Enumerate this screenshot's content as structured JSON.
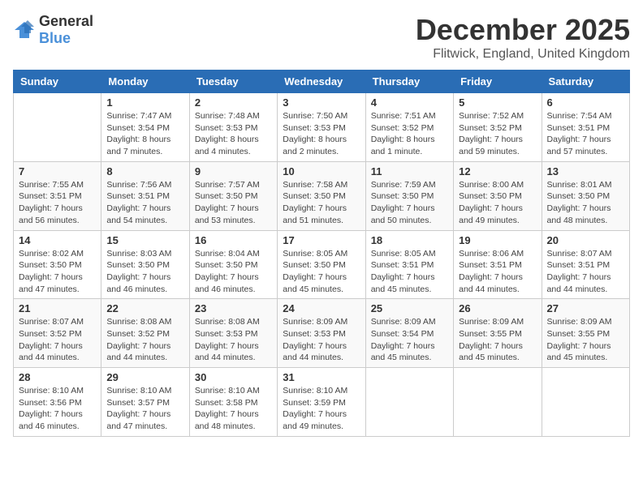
{
  "logo": {
    "general": "General",
    "blue": "Blue"
  },
  "header": {
    "month": "December 2025",
    "location": "Flitwick, England, United Kingdom"
  },
  "weekdays": [
    "Sunday",
    "Monday",
    "Tuesday",
    "Wednesday",
    "Thursday",
    "Friday",
    "Saturday"
  ],
  "weeks": [
    [
      {
        "day": "",
        "info": ""
      },
      {
        "day": "1",
        "info": "Sunrise: 7:47 AM\nSunset: 3:54 PM\nDaylight: 8 hours\nand 7 minutes."
      },
      {
        "day": "2",
        "info": "Sunrise: 7:48 AM\nSunset: 3:53 PM\nDaylight: 8 hours\nand 4 minutes."
      },
      {
        "day": "3",
        "info": "Sunrise: 7:50 AM\nSunset: 3:53 PM\nDaylight: 8 hours\nand 2 minutes."
      },
      {
        "day": "4",
        "info": "Sunrise: 7:51 AM\nSunset: 3:52 PM\nDaylight: 8 hours\nand 1 minute."
      },
      {
        "day": "5",
        "info": "Sunrise: 7:52 AM\nSunset: 3:52 PM\nDaylight: 7 hours\nand 59 minutes."
      },
      {
        "day": "6",
        "info": "Sunrise: 7:54 AM\nSunset: 3:51 PM\nDaylight: 7 hours\nand 57 minutes."
      }
    ],
    [
      {
        "day": "7",
        "info": "Sunrise: 7:55 AM\nSunset: 3:51 PM\nDaylight: 7 hours\nand 56 minutes."
      },
      {
        "day": "8",
        "info": "Sunrise: 7:56 AM\nSunset: 3:51 PM\nDaylight: 7 hours\nand 54 minutes."
      },
      {
        "day": "9",
        "info": "Sunrise: 7:57 AM\nSunset: 3:50 PM\nDaylight: 7 hours\nand 53 minutes."
      },
      {
        "day": "10",
        "info": "Sunrise: 7:58 AM\nSunset: 3:50 PM\nDaylight: 7 hours\nand 51 minutes."
      },
      {
        "day": "11",
        "info": "Sunrise: 7:59 AM\nSunset: 3:50 PM\nDaylight: 7 hours\nand 50 minutes."
      },
      {
        "day": "12",
        "info": "Sunrise: 8:00 AM\nSunset: 3:50 PM\nDaylight: 7 hours\nand 49 minutes."
      },
      {
        "day": "13",
        "info": "Sunrise: 8:01 AM\nSunset: 3:50 PM\nDaylight: 7 hours\nand 48 minutes."
      }
    ],
    [
      {
        "day": "14",
        "info": "Sunrise: 8:02 AM\nSunset: 3:50 PM\nDaylight: 7 hours\nand 47 minutes."
      },
      {
        "day": "15",
        "info": "Sunrise: 8:03 AM\nSunset: 3:50 PM\nDaylight: 7 hours\nand 46 minutes."
      },
      {
        "day": "16",
        "info": "Sunrise: 8:04 AM\nSunset: 3:50 PM\nDaylight: 7 hours\nand 46 minutes."
      },
      {
        "day": "17",
        "info": "Sunrise: 8:05 AM\nSunset: 3:50 PM\nDaylight: 7 hours\nand 45 minutes."
      },
      {
        "day": "18",
        "info": "Sunrise: 8:05 AM\nSunset: 3:51 PM\nDaylight: 7 hours\nand 45 minutes."
      },
      {
        "day": "19",
        "info": "Sunrise: 8:06 AM\nSunset: 3:51 PM\nDaylight: 7 hours\nand 44 minutes."
      },
      {
        "day": "20",
        "info": "Sunrise: 8:07 AM\nSunset: 3:51 PM\nDaylight: 7 hours\nand 44 minutes."
      }
    ],
    [
      {
        "day": "21",
        "info": "Sunrise: 8:07 AM\nSunset: 3:52 PM\nDaylight: 7 hours\nand 44 minutes."
      },
      {
        "day": "22",
        "info": "Sunrise: 8:08 AM\nSunset: 3:52 PM\nDaylight: 7 hours\nand 44 minutes."
      },
      {
        "day": "23",
        "info": "Sunrise: 8:08 AM\nSunset: 3:53 PM\nDaylight: 7 hours\nand 44 minutes."
      },
      {
        "day": "24",
        "info": "Sunrise: 8:09 AM\nSunset: 3:53 PM\nDaylight: 7 hours\nand 44 minutes."
      },
      {
        "day": "25",
        "info": "Sunrise: 8:09 AM\nSunset: 3:54 PM\nDaylight: 7 hours\nand 45 minutes."
      },
      {
        "day": "26",
        "info": "Sunrise: 8:09 AM\nSunset: 3:55 PM\nDaylight: 7 hours\nand 45 minutes."
      },
      {
        "day": "27",
        "info": "Sunrise: 8:09 AM\nSunset: 3:55 PM\nDaylight: 7 hours\nand 45 minutes."
      }
    ],
    [
      {
        "day": "28",
        "info": "Sunrise: 8:10 AM\nSunset: 3:56 PM\nDaylight: 7 hours\nand 46 minutes."
      },
      {
        "day": "29",
        "info": "Sunrise: 8:10 AM\nSunset: 3:57 PM\nDaylight: 7 hours\nand 47 minutes."
      },
      {
        "day": "30",
        "info": "Sunrise: 8:10 AM\nSunset: 3:58 PM\nDaylight: 7 hours\nand 48 minutes."
      },
      {
        "day": "31",
        "info": "Sunrise: 8:10 AM\nSunset: 3:59 PM\nDaylight: 7 hours\nand 49 minutes."
      },
      {
        "day": "",
        "info": ""
      },
      {
        "day": "",
        "info": ""
      },
      {
        "day": "",
        "info": ""
      }
    ]
  ]
}
